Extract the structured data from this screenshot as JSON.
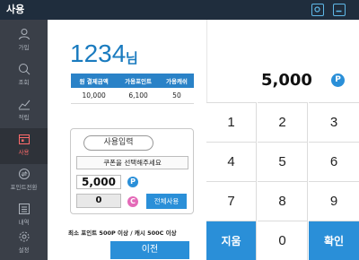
{
  "topbar": {
    "title": "사용",
    "icons": [
      "camera-icon",
      "minimize-icon"
    ]
  },
  "sidebar": {
    "items": [
      {
        "label": "가입",
        "icon": "user-icon"
      },
      {
        "label": "조회",
        "icon": "search-icon"
      },
      {
        "label": "적립",
        "icon": "chart-icon"
      },
      {
        "label": "사용",
        "icon": "calendar-icon",
        "active": true
      },
      {
        "label": "포인트전환",
        "icon": "exchange-icon"
      },
      {
        "label": "내역",
        "icon": "list-icon"
      },
      {
        "label": "설정",
        "icon": "gear-icon"
      }
    ]
  },
  "customer": {
    "number": "1234",
    "suffix": "님"
  },
  "info_table": {
    "headers": [
      "원 결제금액",
      "가용포인트",
      "가용캐쉬"
    ],
    "values": [
      "10,000",
      "6,100",
      "50"
    ]
  },
  "use_input": {
    "label": "사용입력",
    "coupon_placeholder": "쿠폰을 선택해주세요",
    "point_value": "5,000",
    "point_icon": "P",
    "cash_value": "0",
    "cash_icon": "C",
    "all_use_label": "전체사용"
  },
  "notice": "최소 포인트 500P 이상 / 캐시 500C 이상",
  "prev_label": "이전",
  "amount": {
    "value": "5,000",
    "icon": "P"
  },
  "keypad": {
    "keys": [
      "1",
      "2",
      "3",
      "4",
      "5",
      "6",
      "7",
      "8",
      "9",
      "지움",
      "0",
      "확인"
    ]
  },
  "colors": {
    "accent": "#2a8fd8",
    "sidebar": "#3a3f48",
    "topbar": "#1f2d3d",
    "cash": "#e46ab8"
  }
}
